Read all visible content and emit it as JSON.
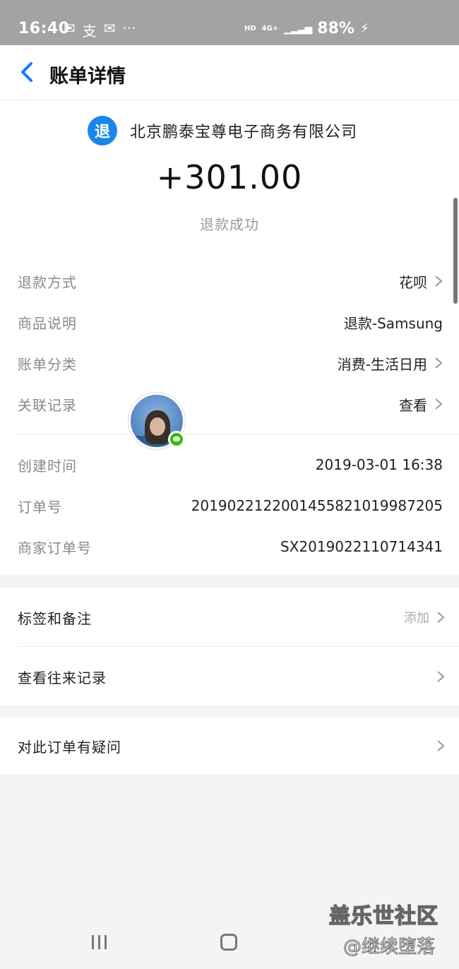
{
  "status_bar": {
    "time": "16:40",
    "notif_icons": [
      "wechat-icon",
      "alipay-icon",
      "wechat-icon"
    ],
    "more": "···",
    "hd": "HD",
    "network": "4G+",
    "battery": "88%"
  },
  "header": {
    "title": "账单详情"
  },
  "bill": {
    "merchant_badge": "退",
    "merchant_name": "北京鹏泰宝尊电子商务有限公司",
    "amount": "+301.00",
    "status": "退款成功"
  },
  "details": [
    {
      "label": "退款方式",
      "value": "花呗",
      "chevron": true
    },
    {
      "label": "商品说明",
      "value": "退款-Samsung",
      "chevron": false
    },
    {
      "label": "账单分类",
      "value": "消费-生活日用",
      "chevron": true
    },
    {
      "label": "关联记录",
      "value": "查看",
      "chevron": true
    }
  ],
  "order_info": [
    {
      "label": "创建时间",
      "value": "2019-03-01 16:38"
    },
    {
      "label": "订单号",
      "value": "2019022122001455821019987205"
    },
    {
      "label": "商家订单号",
      "value": "SX2019022110714341"
    }
  ],
  "actions": {
    "tags_label": "标签和备注",
    "tags_value": "添加",
    "history_label": "查看往来记录",
    "question_label": "对此订单有疑问"
  },
  "watermark": {
    "line1": "盖乐世社区",
    "line2": "@继续堕落"
  },
  "colors": {
    "accent": "#1677ff",
    "badge": "#1a86e8",
    "statusbar": "#a3a3a3"
  }
}
